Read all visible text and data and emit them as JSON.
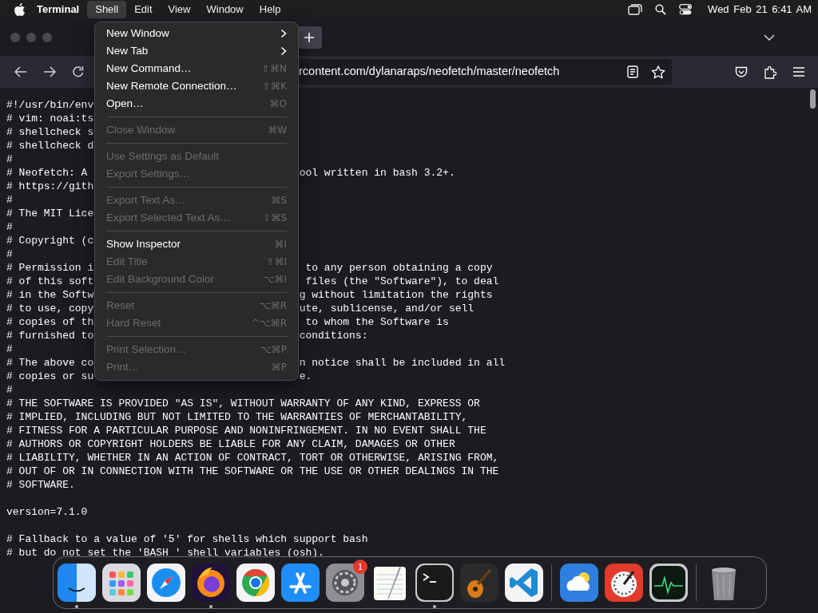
{
  "menubar": {
    "app": "Terminal",
    "menus": [
      {
        "label": "Shell",
        "selected": true
      },
      {
        "label": "Edit",
        "selected": false
      },
      {
        "label": "View",
        "selected": false
      },
      {
        "label": "Window",
        "selected": false
      },
      {
        "label": "Help",
        "selected": false
      }
    ],
    "clock": "Wed Feb 21 6:41 AM"
  },
  "browser": {
    "url": "rcontent.com/dylanaraps/neofetch/master/neofetch",
    "code_lines": [
      {
        "kind": "split",
        "left": "#!/usr/bin/env"
      },
      {
        "kind": "split",
        "left": "# vim: noai:ts"
      },
      {
        "kind": "split",
        "left": "# shellcheck s"
      },
      {
        "kind": "split",
        "left": "# shellcheck d"
      },
      {
        "kind": "full",
        "text": "#"
      },
      {
        "kind": "split",
        "left": "# Neofetch: A",
        "right": "ool written in bash 3.2+."
      },
      {
        "kind": "split",
        "left": "# https://gith"
      },
      {
        "kind": "full",
        "text": "#"
      },
      {
        "kind": "split",
        "left": "# The MIT Lice"
      },
      {
        "kind": "full",
        "text": "#"
      },
      {
        "kind": "split",
        "left": "# Copyright (c"
      },
      {
        "kind": "full",
        "text": "#"
      },
      {
        "kind": "split",
        "left": "# Permission i",
        "right": " to any person obtaining a copy"
      },
      {
        "kind": "split",
        "left": "# of this soft",
        "right": " files (the \"Software\"), to deal"
      },
      {
        "kind": "split",
        "left": "# in the Softw",
        "right": "g without limitation the rights"
      },
      {
        "kind": "split",
        "left": "# to use, copy",
        "right": "ute, sublicense, and/or sell"
      },
      {
        "kind": "split",
        "left": "# copies of th",
        "right": " to whom the Software is"
      },
      {
        "kind": "split",
        "left": "# furnished to",
        "right": "conditions:"
      },
      {
        "kind": "full",
        "text": "#"
      },
      {
        "kind": "split",
        "left": "# The above co",
        "right": "n notice shall be included in all"
      },
      {
        "kind": "split",
        "left": "# copies or su",
        "right": "e."
      },
      {
        "kind": "full",
        "text": "#"
      },
      {
        "kind": "full",
        "text": "# THE SOFTWARE IS PROVIDED \"AS IS\", WITHOUT WARRANTY OF ANY KIND, EXPRESS OR"
      },
      {
        "kind": "full",
        "text": "# IMPLIED, INCLUDING BUT NOT LIMITED TO THE WARRANTIES OF MERCHANTABILITY,"
      },
      {
        "kind": "full",
        "text": "# FITNESS FOR A PARTICULAR PURPOSE AND NONINFRINGEMENT. IN NO EVENT SHALL THE"
      },
      {
        "kind": "full",
        "text": "# AUTHORS OR COPYRIGHT HOLDERS BE LIABLE FOR ANY CLAIM, DAMAGES OR OTHER"
      },
      {
        "kind": "full",
        "text": "# LIABILITY, WHETHER IN AN ACTION OF CONTRACT, TORT OR OTHERWISE, ARISING FROM,"
      },
      {
        "kind": "full",
        "text": "# OUT OF OR IN CONNECTION WITH THE SOFTWARE OR THE USE OR OTHER DEALINGS IN THE"
      },
      {
        "kind": "full",
        "text": "# SOFTWARE."
      },
      {
        "kind": "blank"
      },
      {
        "kind": "full",
        "text": "version=7.1.0"
      },
      {
        "kind": "blank"
      },
      {
        "kind": "full",
        "text": "# Fallback to a value of '5' for shells which support bash"
      },
      {
        "kind": "full",
        "text": "# but do not set the 'BASH_' shell variables (osh)."
      }
    ]
  },
  "shell_menu": {
    "groups": [
      [
        {
          "label": "New Window",
          "submenu": true,
          "disabled": false
        },
        {
          "label": "New Tab",
          "submenu": true,
          "disabled": false
        },
        {
          "label": "New Command…",
          "shortcut": "⇧⌘N",
          "submenu": false,
          "disabled": false
        },
        {
          "label": "New Remote Connection…",
          "shortcut": "⇧⌘K",
          "submenu": false,
          "disabled": false
        },
        {
          "label": "Open…",
          "shortcut": "⌘O",
          "submenu": false,
          "disabled": false
        }
      ],
      [
        {
          "label": "Close Window",
          "shortcut": "⌘W",
          "submenu": false,
          "disabled": true
        }
      ],
      [
        {
          "label": "Use Settings as Default",
          "submenu": false,
          "disabled": true
        },
        {
          "label": "Export Settings…",
          "submenu": false,
          "disabled": true
        }
      ],
      [
        {
          "label": "Export Text As…",
          "shortcut": "⌘S",
          "submenu": false,
          "disabled": true
        },
        {
          "label": "Export Selected Text As…",
          "shortcut": "⇧⌘S",
          "submenu": false,
          "disabled": true
        }
      ],
      [
        {
          "label": "Show Inspector",
          "shortcut": "⌘I",
          "submenu": false,
          "disabled": false
        },
        {
          "label": "Edit Title",
          "shortcut": "⇧⌘I",
          "submenu": false,
          "disabled": true
        },
        {
          "label": "Edit Background Color",
          "shortcut": "⌥⌘I",
          "submenu": false,
          "disabled": true
        }
      ],
      [
        {
          "label": "Reset",
          "shortcut": "⌥⌘R",
          "submenu": false,
          "disabled": true
        },
        {
          "label": "Hard Reset",
          "shortcut": "^⌥⌘R",
          "submenu": false,
          "disabled": true
        }
      ],
      [
        {
          "label": "Print Selection…",
          "shortcut": "⌥⌘P",
          "submenu": false,
          "disabled": true
        },
        {
          "label": "Print…",
          "shortcut": "⌘P",
          "submenu": false,
          "disabled": true
        }
      ]
    ]
  },
  "dock": {
    "items": [
      {
        "kind": "finder",
        "running": true
      },
      {
        "kind": "launchpad",
        "running": false
      },
      {
        "kind": "safari",
        "running": false
      },
      {
        "kind": "firefox",
        "running": true
      },
      {
        "kind": "chrome",
        "running": false
      },
      {
        "kind": "appstore",
        "running": false
      },
      {
        "kind": "settings",
        "running": false,
        "badge": "1"
      },
      {
        "kind": "textedit",
        "running": false
      },
      {
        "kind": "terminal",
        "running": true
      },
      {
        "kind": "garageband",
        "running": false
      },
      {
        "kind": "vscode",
        "running": false
      },
      {
        "kind": "separator"
      },
      {
        "kind": "weather",
        "running": false
      },
      {
        "kind": "gauge",
        "running": false
      },
      {
        "kind": "activity",
        "running": false
      },
      {
        "kind": "separator"
      },
      {
        "kind": "trash",
        "running": false
      }
    ]
  }
}
